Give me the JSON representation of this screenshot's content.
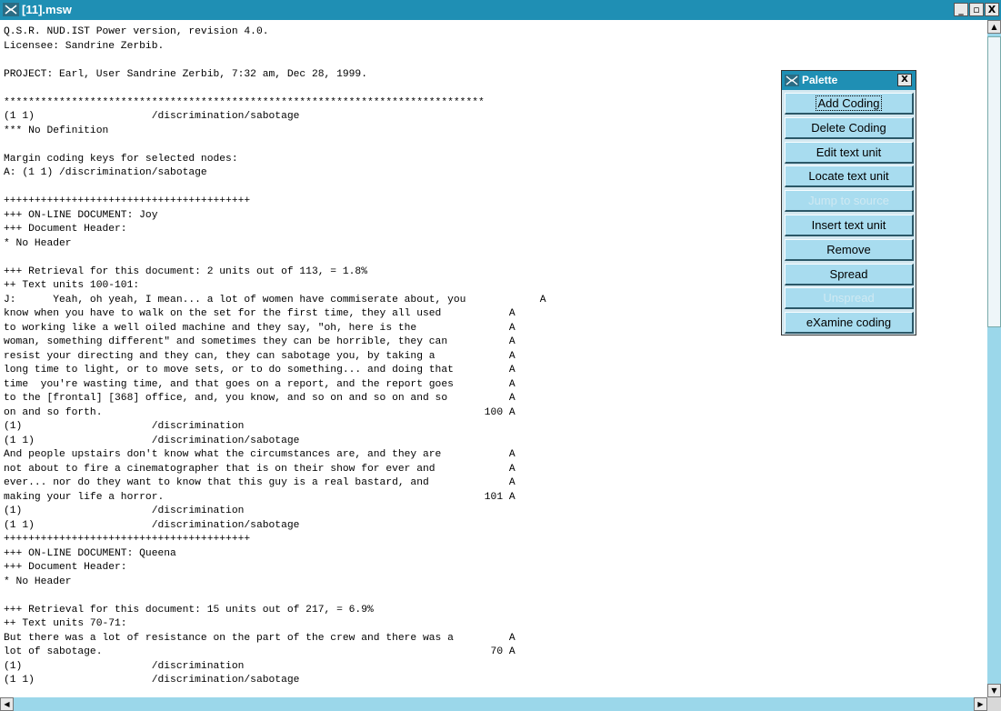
{
  "window": {
    "title": "[11].msw",
    "minimize_glyph": "_",
    "restore_glyph": "▫",
    "close_glyph": "X"
  },
  "document": {
    "text": "Q.S.R. NUD.IST Power version, revision 4.0.\nLicensee: Sandrine Zerbib.\n\nPROJECT: Earl, User Sandrine Zerbib, 7:32 am, Dec 28, 1999.\n\n******************************************************************************\n(1 1)                   /discrimination/sabotage\n*** No Definition\n\nMargin coding keys for selected nodes:\nA: (1 1) /discrimination/sabotage\n\n++++++++++++++++++++++++++++++++++++++++\n+++ ON-LINE DOCUMENT: Joy\n+++ Document Header:\n* No Header\n\n+++ Retrieval for this document: 2 units out of 113, = 1.8%\n++ Text units 100-101:\nJ:      Yeah, oh yeah, I mean... a lot of women have commiserate about, you            A\nknow when you have to walk on the set for the first time, they all used           A\nto working like a well oiled machine and they say, \"oh, here is the               A\nwoman, something different\" and sometimes they can be horrible, they can          A\nresist your directing and they can, they can sabotage you, by taking a            A\nlong time to light, or to move sets, or to do something... and doing that         A\ntime  you're wasting time, and that goes on a report, and the report goes         A\nto the [frontal] [368] office, and, you know, and so on and so on and so          A\non and so forth.                                                              100 A\n(1)                     /discrimination\n(1 1)                   /discrimination/sabotage\nAnd people upstairs don't know what the circumstances are, and they are           A\nnot about to fire a cinematographer that is on their show for ever and            A\never... nor do they want to know that this guy is a real bastard, and             A\nmaking your life a horror.                                                    101 A\n(1)                     /discrimination\n(1 1)                   /discrimination/sabotage\n++++++++++++++++++++++++++++++++++++++++\n+++ ON-LINE DOCUMENT: Queena\n+++ Document Header:\n* No Header\n\n+++ Retrieval for this document: 15 units out of 217, = 6.9%\n++ Text units 70-71:\nBut there was a lot of resistance on the part of the crew and there was a         A\nlot of sabotage.                                                               70 A\n(1)                     /discrimination\n(1 1)                   /discrimination/sabotage"
  },
  "palette": {
    "title": "Palette",
    "close_glyph": "X",
    "buttons": [
      {
        "label": "Add Coding",
        "enabled": true,
        "focused": true
      },
      {
        "label": "Delete Coding",
        "enabled": true
      },
      {
        "label": "Edit text unit",
        "enabled": true
      },
      {
        "label": "Locate text unit",
        "enabled": true
      },
      {
        "label": "Jump to source",
        "enabled": false
      },
      {
        "label": "Insert text unit",
        "enabled": true
      },
      {
        "label": "Remove",
        "enabled": true
      },
      {
        "label": "Spread",
        "enabled": true
      },
      {
        "label": "Unspread",
        "enabled": false
      },
      {
        "label": "eXamine coding",
        "enabled": true
      }
    ]
  },
  "scrollbars": {
    "up_glyph": "▲",
    "down_glyph": "▼",
    "left_glyph": "◀",
    "right_glyph": "▶"
  }
}
